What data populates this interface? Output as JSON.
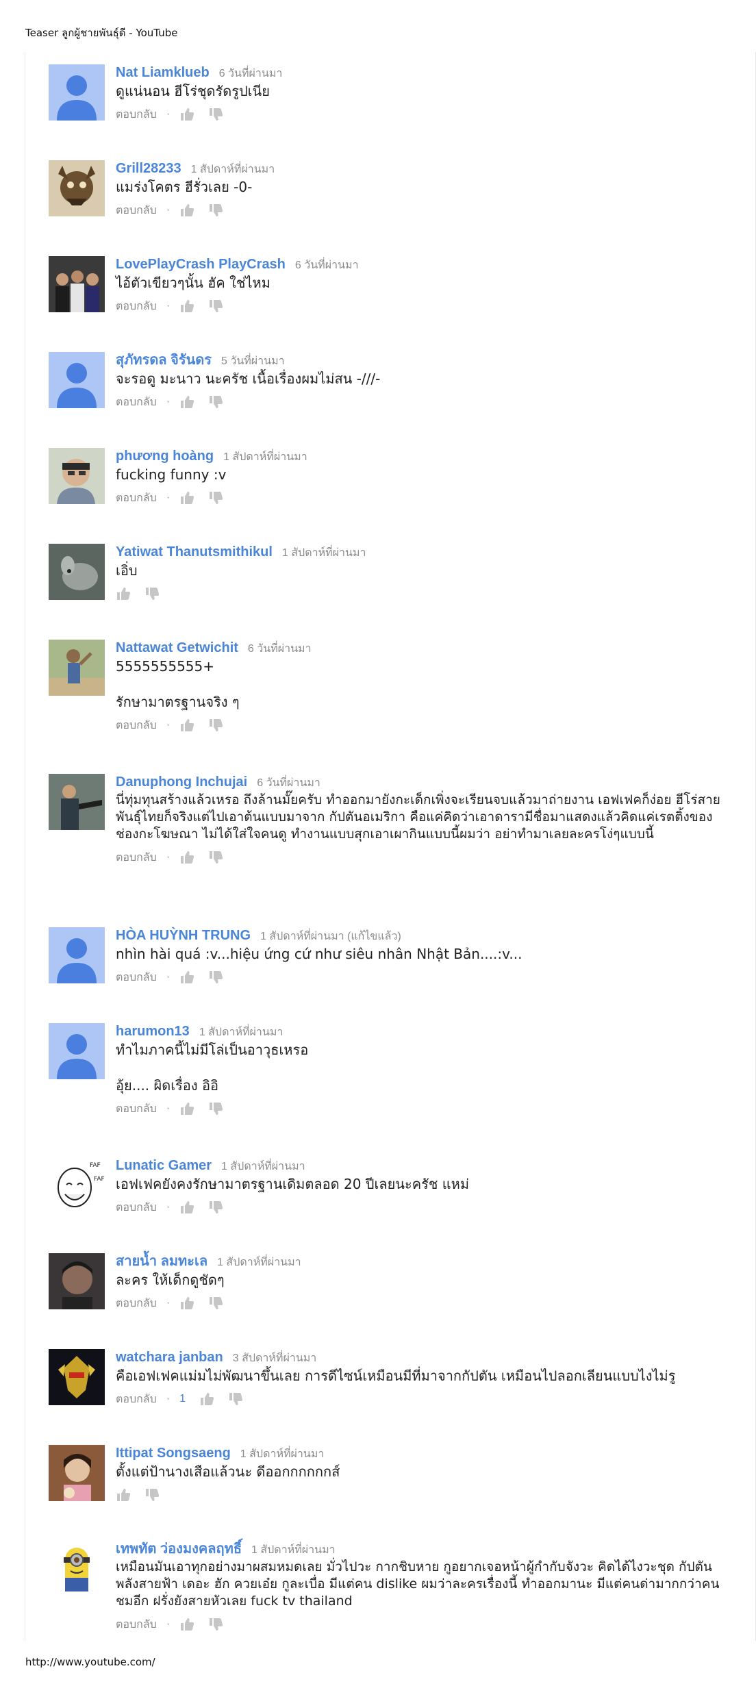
{
  "page": {
    "header_title": "Teaser ลูกผู้ชายพันธุ์ดี - YouTube",
    "footer_url": "http://www.youtube.com/"
  },
  "colors": {
    "author": "#4a85d7",
    "time": "#8a8a8a",
    "text": "#222222",
    "thumb": "#c6c6c6"
  },
  "comments": [
    {
      "author": "Nat Liamklueb",
      "time": "6 วันที่ผ่านมา",
      "text": "ดูแน่นอน ฮีโร่ชุดรัดรูปเนีย",
      "reply": "ตอบกลับ",
      "avatar": "default-avatar-icon"
    },
    {
      "author": "Grill28233",
      "time": "1 สัปดาห์ที่ผ่านมา",
      "text": "แมร่งโคตร ฮีรั่วเลย -0-",
      "reply": "ตอบกลับ",
      "avatar": "user-photo"
    },
    {
      "author": "LovePlayCrash PlayCrash",
      "time": "6 วันที่ผ่านมา",
      "text": "ไอ้ตัวเขียวๆนั้น ฮัค ใช่ไหม",
      "reply": "ตอบกลับ",
      "avatar": "user-photo"
    },
    {
      "author": "สุภัทรดล จิรันดร",
      "time": "5 วันที่ผ่านมา",
      "text": "จะรอดู มะนาว นะครัช เนื้อเรื่องผมไม่สน -///-",
      "reply": "ตอบกลับ",
      "avatar": "default-avatar-icon"
    },
    {
      "author": "phương hoàng",
      "time": "1 สัปดาห์ที่ผ่านมา",
      "text": "fucking funny :v",
      "reply": "ตอบกลับ",
      "avatar": "user-photo"
    },
    {
      "author": "Yatiwat Thanutsmithikul",
      "time": "1 สัปดาห์ที่ผ่านมา",
      "text": "เอิ่บ",
      "reply": "",
      "avatar": "user-photo"
    },
    {
      "author": "Nattawat Getwichit",
      "time": "6 วันที่ผ่านมา",
      "text": "5555555555+\n\nรักษามาตรฐานจริง ๆ",
      "reply": "ตอบกลับ",
      "avatar": "user-photo"
    },
    {
      "author": "Danuphong Inchujai",
      "time": "6 วันที่ผ่านมา",
      "text": "นี่ทุ่มทุนสร้างแล้วเหรอ ถึงล้านมั๊ยครับ ทำออกมายังกะเด็กเพิ่งจะเรียนจบแล้วมาถ่ายงาน เอฟเฟคก็ง่อย ฮีโร่สายพันธุ์ไทยก็จริงแต่ไปเอาต้นแบบมาจาก กัปตันอเมริกา คือแค่คิดว่าเอาดารามีชื่อมาแสดงแล้วคิดแค่เรตติ้งของช่องกะโฆษณา ไม่ได้ใส่ใจคนดู ทำงานแบบสุกเอาเผากินแบบนี้ผมว่า อย่าทำมาเลยละครโง่ๆแบบนี้",
      "reply": "ตอบกลับ",
      "avatar": "user-photo"
    },
    {
      "author": "HÒA HUỲNH TRUNG",
      "time": "1 สัปดาห์ที่ผ่านมา (แก้ไขแล้ว)",
      "text": "nhìn hài quá :v...hiệu ứng cứ như siêu nhân Nhật Bản....:v...",
      "reply": "ตอบกลับ",
      "avatar": "default-avatar-icon"
    },
    {
      "author": "harumon13",
      "time": "1 สัปดาห์ที่ผ่านมา",
      "text": "ทำไมภาคนี้ไม่มีโล่เป็นอาวุธเหรอ\n\nอุ้ย.... ผิดเรื่อง อิอิ",
      "reply": "ตอบกลับ",
      "avatar": "default-avatar-icon"
    },
    {
      "author": "Lunatic Gamer",
      "time": "1 สัปดาห์ที่ผ่านมา",
      "text": "เอฟเฟคยังคงรักษามาตรฐานเดิมตลอด 20 ปีเลยนะครัช แหม่",
      "reply": "ตอบกลับ",
      "avatar": "meme-face"
    },
    {
      "author": "สายน้ำ ลมทะเล",
      "time": "1 สัปดาห์ที่ผ่านมา",
      "text": "ละคร ให้เด็กดูชัดๆ",
      "reply": "ตอบกลับ",
      "avatar": "user-photo"
    },
    {
      "author": "watchara janban",
      "time": "3 สัปดาห์ที่ผ่านมา",
      "text": "คือเอฟเฟคแม่มไม่พัฒนาขึ้นเลย การดีไซน์เหมือนมีที่มาจากกัปตัน เหมือนไปลอกเลียนแบบไงไม่รู",
      "reply": "ตอบกลับ",
      "likes": "1",
      "avatar": "user-photo"
    },
    {
      "author": "Ittipat Songsaeng",
      "time": "1 สัปดาห์ที่ผ่านมา",
      "text": "ตั้งแต่ป้านางเสือแล้วนะ ดีออกกกกกกส์",
      "reply": "",
      "avatar": "user-photo"
    },
    {
      "author": "เทพทัต ว่องมงคลฤทธิ์",
      "time": "1 สัปดาห์ที่ผ่านมา",
      "text": "เหมือนมันเอาทุกอย่างมาผสมหมดเลย มั่วไปวะ กากชิบหาย กูอยากเจอหน้าผู้กำกับจังวะ คิดได้ไงวะชุด กัปตัน พลังสายฟ้า เดอะ ฮัก ควยเอ๋ย กูละเบื่อ มีแต่คน dislike ผมว่าละครเรื่องนี้ ทำออกมานะ มีแต่คนด่ามากกว่าคนชมอีก ฝรั่งยังสายหัวเลย fuck tv thailand",
      "reply": "ตอบกลับ",
      "avatar": "minion-photo"
    }
  ]
}
